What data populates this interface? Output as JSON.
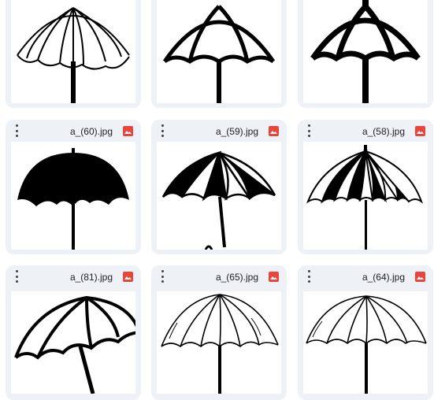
{
  "colors": {
    "tile_background": "#eef1f6",
    "image_badge": "#e8453c",
    "text": "#202124"
  },
  "icons": {
    "menu": "more-vert-icon",
    "file_type": "image-icon"
  },
  "files": [
    {
      "name": ""
    },
    {
      "name": ""
    },
    {
      "name": ""
    },
    {
      "name": "a_(60).jpg"
    },
    {
      "name": "a_(59).jpg"
    },
    {
      "name": "a_(58).jpg"
    },
    {
      "name": "a_(81).jpg"
    },
    {
      "name": "a_(65).jpg"
    },
    {
      "name": "a_(64).jpg"
    }
  ]
}
